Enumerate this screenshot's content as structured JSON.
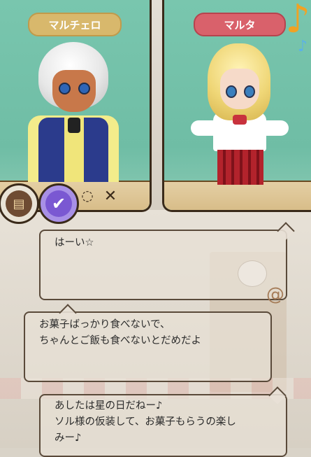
{
  "left_character": {
    "name": "マルチェロ"
  },
  "right_character": {
    "name": "マルタ"
  },
  "messages": [
    {
      "lines": [
        "はーい☆"
      ]
    },
    {
      "lines": [
        "お菓子ばっかり食べないで、",
        "ちゃんとご飯も食べないとだめだよ"
      ]
    },
    {
      "lines": [
        "あしたは星の日だねー♪",
        "ソル様の仮装して、お菓子もらうの楽し",
        "みー♪"
      ]
    }
  ],
  "icons": [
    "book-icon",
    "check-icon",
    "ring-icon",
    "crossed-swords-icon",
    "music-note-icon",
    "snail-icon"
  ],
  "colors": {
    "panel_bg": "#74c1a9",
    "left_nameplate": "#d8b86c",
    "right_nameplate": "#d9616b",
    "frame": "#3a2a1a"
  }
}
